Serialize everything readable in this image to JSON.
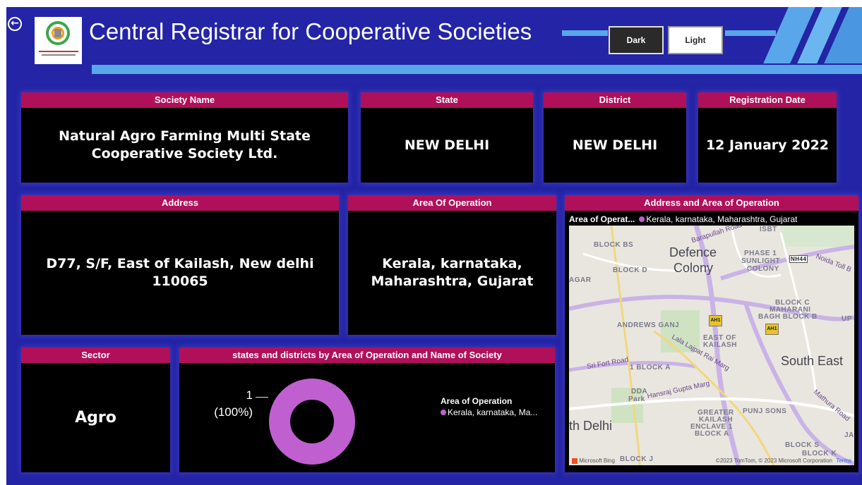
{
  "header": {
    "title": "Central Registrar for Cooperative Societies",
    "theme_dark": "Dark",
    "theme_light": "Light"
  },
  "cards": {
    "society_name": {
      "label": "Society Name",
      "value": "Natural Agro Farming Multi State Cooperative Society Ltd."
    },
    "state": {
      "label": "State",
      "value": "NEW DELHI"
    },
    "district": {
      "label": "District",
      "value": "NEW DELHI"
    },
    "registration_date": {
      "label": "Registration Date",
      "value": "12 January 2022"
    },
    "address": {
      "label": "Address",
      "value": "D77, S/F, East of Kailash, New delhi 110065"
    },
    "area_of_operation": {
      "label": "Area Of Operation",
      "value": "Kerala, karnataka, Maharashtra, Gujarat"
    },
    "sector": {
      "label": "Sector",
      "value": "Agro"
    }
  },
  "map_visual": {
    "title": "Address and Area of Operation",
    "legend_title": "Area of Operat...",
    "legend_item": "Kerala, karnataka, Maharashtra, Gujarat",
    "place_labels": {
      "block_bs": "BLOCK BS",
      "defence": "Defence",
      "colony": "Colony",
      "phase1": "PHASE 1",
      "sunlight": "SUNLIGHT",
      "colony_small": "COLONY",
      "nh44": "NH44",
      "block_d": "BLOCK D",
      "agar": "AGAR",
      "isbt": "ISBT",
      "barapullah": "Barapullah Road",
      "noida_toll": "Noida Toll B",
      "block_c": "BLOCK C",
      "maharani": "MAHARANI",
      "bagh_block_b": "BAGH BLOCK B",
      "up": "UP",
      "andrews_ganj": "ANDREWS GANJ",
      "east_of": "EAST OF",
      "kailash": "KAILASH",
      "ah1": "AH1",
      "lala_lajpat": "Lala Lajpat Rai Marg",
      "sri_fort": "Sri Fort Road",
      "block_1a": "1 BLOCK A",
      "south_east": "South East",
      "dda": "DDA",
      "park": "Park",
      "hansraj": "Hansraj Gupta Marg",
      "greater": "GREATER",
      "kailash2": "KAILASH",
      "enclave1": "ENCLAVE 1",
      "block_a": "BLOCK A",
      "punj_sons": "PUNJ SONS",
      "mathura": "Mathura Road",
      "th_delhi": "th Delhi",
      "block_s": "BLOCK S",
      "ja": "JA",
      "block_j": "BLOCK J",
      "block_k": "BLOCK K"
    },
    "attribution_left": "Microsoft Bing",
    "attribution_right": "©2023 TomTom, © 2023 Microsoft Corporation",
    "terms": "Terms"
  },
  "donut_visual": {
    "title": "states and districts by Area of Operation and Name of Society",
    "data_label_value": "1",
    "data_label_percent": "(100%)",
    "legend_title": "Area of Operation",
    "legend_item": "Kerala, karnataka, Ma..."
  },
  "chart_data": {
    "type": "pie",
    "title": "states and districts by Area of Operation and Name of Society",
    "categories": [
      "Kerala, karnataka, Maharashtra, Gujarat"
    ],
    "values": [
      1
    ],
    "percentages": [
      100
    ],
    "legend_title": "Area of Operation",
    "colors": [
      "#c060d0"
    ]
  },
  "colors": {
    "background": "#2324a6",
    "card_header": "#b0105a",
    "card_body": "#000000",
    "accent_blue": "#5aa6ea",
    "donut": "#c060d0"
  }
}
